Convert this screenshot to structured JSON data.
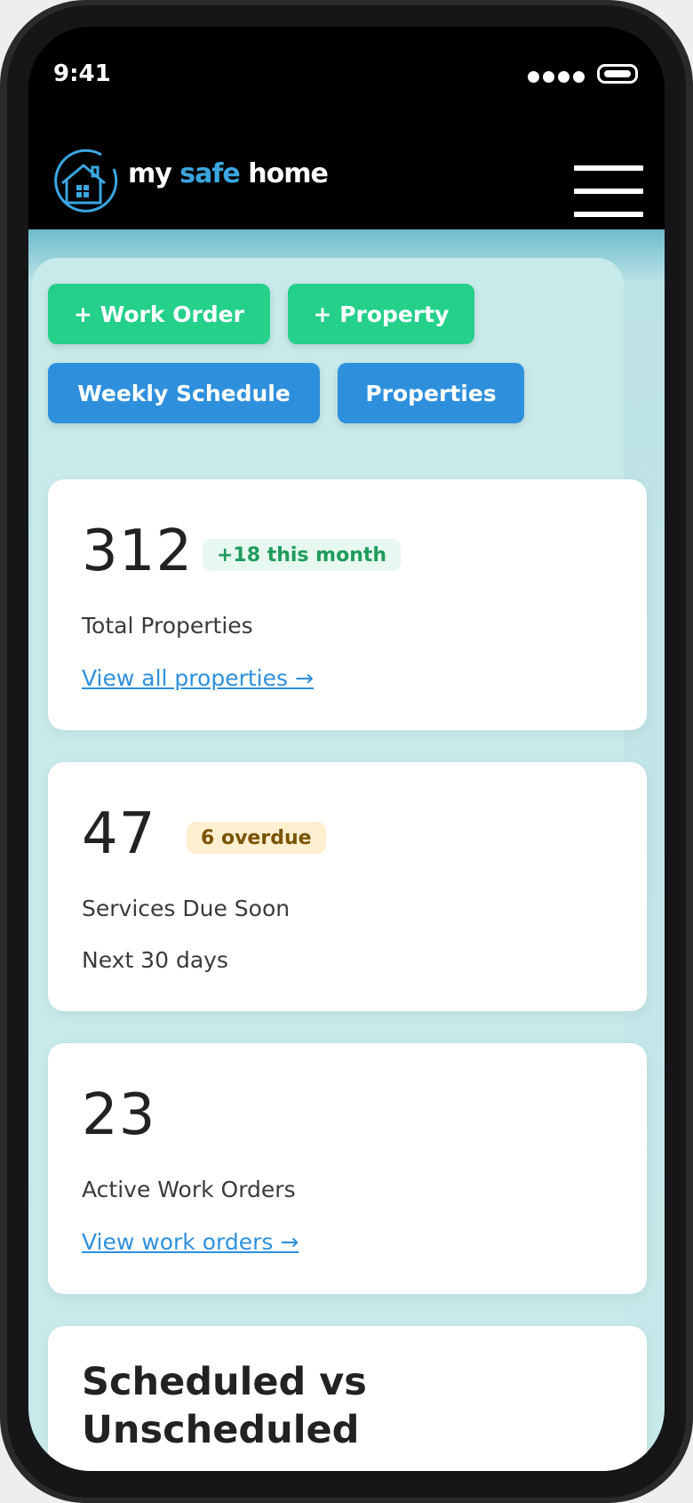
{
  "status_bar": {
    "time": "9:41"
  },
  "header": {
    "logo_parts": [
      "my",
      "safe",
      "home"
    ],
    "menu_icon": "hamburger-menu-icon",
    "logo_icon": "house-circle-logo-icon"
  },
  "quick_actions": {
    "add_work_order": "+ Work Order",
    "add_property": "+ Property",
    "weekly_schedule": "Weekly Schedule",
    "properties": "Properties"
  },
  "cards": {
    "total_properties": {
      "value": "312",
      "badge": "+18 this month",
      "label": "Total Properties",
      "link": "View all properties →"
    },
    "services_due": {
      "value": "47",
      "badge": "6 overdue",
      "label": "Services Due Soon",
      "sublabel": "Next 30 days"
    },
    "work_orders": {
      "value": "23",
      "label": "Active Work Orders",
      "link": "View work orders →"
    },
    "schedule": {
      "title": "Scheduled vs Unscheduled"
    }
  },
  "colors": {
    "accent_green": "#24d08a",
    "accent_blue": "#2e90dd",
    "panel_bg": "#c8eaea",
    "badge_green_text": "#1f9c5c",
    "badge_amber_text": "#7b5303"
  }
}
